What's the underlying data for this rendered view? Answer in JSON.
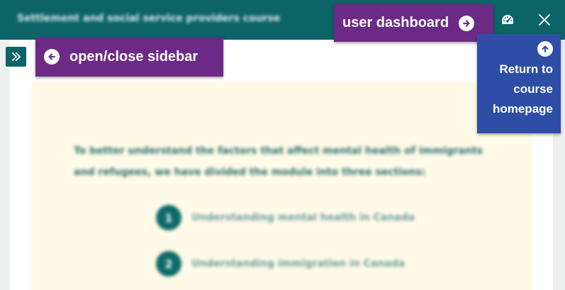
{
  "header": {
    "course_title": "Settlement and social service providers course",
    "dashboard_icon": "speedometer-icon",
    "close_icon": "close-icon"
  },
  "sidebar_toggle": {
    "icon": "double-chevron-right-icon"
  },
  "content": {
    "intro": "To better understand the factors that affect mental health of immigrants and refugees, we have divided the module into three sections:",
    "sections": [
      {
        "number": "1",
        "label": "Understanding mental health in Canada"
      },
      {
        "number": "2",
        "label": "Understanding immigration in Canada"
      }
    ]
  },
  "tooltips": {
    "sidebar": {
      "label": "open/close sidebar",
      "icon": "arrow-left-circle-icon"
    },
    "dashboard": {
      "label": "user dashboard",
      "icon": "arrow-right-circle-icon"
    },
    "return": {
      "label": "Return to\ncourse\nhomepage",
      "icon": "arrow-up-circle-icon"
    }
  },
  "colors": {
    "teal": "#0c6466",
    "purple_tooltip": "#6c2a86",
    "blue_tooltip": "#2e4ea6",
    "intro_background": "#fffbe8"
  }
}
